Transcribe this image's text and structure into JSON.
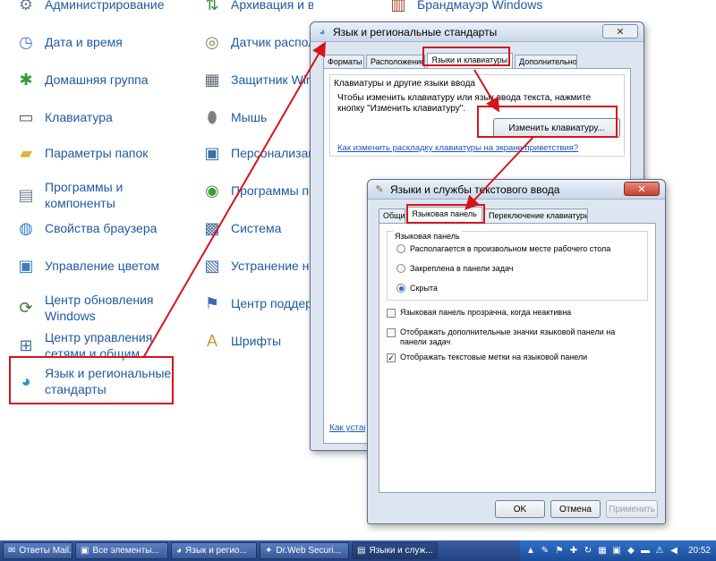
{
  "control_panel": {
    "col1": [
      {
        "label": "Администрирование",
        "icon": "admin-tools-icon",
        "glyph": "⚙",
        "color": "#6b7f96"
      },
      {
        "label": "Дата и время",
        "icon": "clock-icon",
        "glyph": "◷",
        "color": "#4a82c6"
      },
      {
        "label": "Домашняя группа",
        "icon": "homegroup-icon",
        "glyph": "✱",
        "color": "#2f9a3a"
      },
      {
        "label": "Клавиатура",
        "icon": "keyboard-icon",
        "glyph": "▭",
        "color": "#555c66"
      },
      {
        "label": "Параметры папок",
        "icon": "folder-icon",
        "glyph": "▰",
        "color": "#e0b33c"
      },
      {
        "label": "Программы и компоненты",
        "icon": "programs-icon",
        "glyph": "▤",
        "color": "#6e7f94"
      },
      {
        "label": "Свойства браузера",
        "icon": "browser-globe-icon",
        "glyph": "◍",
        "color": "#2f7fc8"
      },
      {
        "label": "Управление цветом",
        "icon": "color-monitor-icon",
        "glyph": "▣",
        "color": "#3b7dc0"
      },
      {
        "label": "Центр обновления Windows",
        "icon": "windows-update-icon",
        "glyph": "⟳",
        "color": "#3b7a2c"
      },
      {
        "label": "Центр управления сетями и общим",
        "icon": "network-icon",
        "glyph": "⊞",
        "color": "#4a6fa0"
      },
      {
        "label": "Язык и региональные стандарты",
        "icon": "region-globe-icon",
        "glyph": "◕",
        "color": "#2d8fcf"
      }
    ],
    "col2": [
      {
        "label": "Архивация и восстановление",
        "icon": "backup-icon",
        "glyph": "⇅",
        "color": "#3c8f43"
      },
      {
        "label": "Датчик расположения и другие датчики",
        "icon": "sensor-icon",
        "glyph": "◎",
        "color": "#7a8a56"
      },
      {
        "label": "Защитник Windows",
        "icon": "defender-icon",
        "glyph": "▦",
        "color": "#5d6874"
      },
      {
        "label": "Мышь",
        "icon": "mouse-icon",
        "glyph": "⬮",
        "color": "#7b7f86"
      },
      {
        "label": "Персонализация",
        "icon": "personalization-icon",
        "glyph": "▣",
        "color": "#3d6fa8"
      },
      {
        "label": "Программы по умолчанию",
        "icon": "default-programs-icon",
        "glyph": "◉",
        "color": "#3e9a3a"
      },
      {
        "label": "Система",
        "icon": "system-icon",
        "glyph": "▩",
        "color": "#4b6c9a"
      },
      {
        "label": "Устранение неполадок",
        "icon": "troubleshoot-icon",
        "glyph": "▧",
        "color": "#3f6fab"
      },
      {
        "label": "Центр поддержки",
        "icon": "action-center-flag-icon",
        "glyph": "⚑",
        "color": "#3b69b0"
      },
      {
        "label": "Шрифты",
        "icon": "fonts-icon",
        "glyph": "A",
        "color": "#c99a2c"
      }
    ],
    "col3": [
      {
        "label": "Брандмауэр Windows",
        "icon": "firewall-icon",
        "glyph": "▥",
        "color": "#a2492d"
      }
    ]
  },
  "region_dialog": {
    "title": "Язык и региональные стандарты",
    "close": "✕",
    "tabs": [
      "Форматы",
      "Расположение",
      "Языки и клавиатуры",
      "Дополнительно"
    ],
    "active_tab_index": 2,
    "group_title": "Клавиатуры и другие языки ввода",
    "description": "Чтобы изменить клавиатуру или язык ввода текста, нажмите кнопку \"Изменить клавиатуру\".",
    "change_button": "Изменить клавиатуру...",
    "welcome_link": "Как изменить раскладку клавиатуры на экране приветствия?",
    "bottom_link": "Как установить"
  },
  "lang_dialog": {
    "title": "Языки и службы текстового ввода",
    "close": "✕",
    "tabs": [
      "Общие",
      "Языковая панель",
      "Переключение клавиатуры"
    ],
    "active_tab_index": 1,
    "group_title": "Языковая панель",
    "radios": [
      {
        "label": "Располагается в произвольном месте рабочего стола",
        "selected": false
      },
      {
        "label": "Закреплена в панели задач",
        "selected": false
      },
      {
        "label": "Скрыта",
        "selected": true
      }
    ],
    "checkboxes": [
      {
        "label": "Языковая панель прозрачна, когда неактивна",
        "checked": false
      },
      {
        "label": "Отображать дополнительные значки языковой панели на панели задач",
        "checked": false
      },
      {
        "label": "Отображать текстовые метки на языковой панели",
        "checked": true
      }
    ],
    "ok": "OK",
    "cancel": "Отмена",
    "apply": "Применить"
  },
  "taskbar": {
    "buttons": [
      {
        "label": "Ответы Mail.R...",
        "icon": "mail-icon",
        "glyph": "✉",
        "active": false
      },
      {
        "label": "Все элементы...",
        "icon": "explorer-icon",
        "glyph": "▣",
        "active": false
      },
      {
        "label": "Язык и регио...",
        "icon": "region-icon",
        "glyph": "◕",
        "active": false
      },
      {
        "label": "Dr.Web Securi...",
        "icon": "drweb-icon",
        "glyph": "✦",
        "active": false
      },
      {
        "label": "Языки и служ...",
        "icon": "language-icon",
        "glyph": "▤",
        "active": true
      }
    ],
    "clock": "20:52",
    "tray_icons": [
      {
        "icon": "expand-tray-icon",
        "glyph": "▲"
      },
      {
        "icon": "notes-icon",
        "glyph": "✎"
      },
      {
        "icon": "flag-icon",
        "glyph": "⚑"
      },
      {
        "icon": "antivirus-icon",
        "glyph": "✚"
      },
      {
        "icon": "refresh-icon",
        "glyph": "↻"
      },
      {
        "icon": "network-tray-icon",
        "glyph": "▦"
      },
      {
        "icon": "monitor-tray-icon",
        "glyph": "▣"
      },
      {
        "icon": "shield-tray-icon",
        "glyph": "◆"
      },
      {
        "icon": "russian-flag-icon",
        "glyph": "▬"
      },
      {
        "icon": "warning-tray-icon",
        "glyph": "⚠"
      },
      {
        "icon": "volume-icon",
        "glyph": "◀"
      }
    ]
  },
  "accent_color": "#d4141b"
}
